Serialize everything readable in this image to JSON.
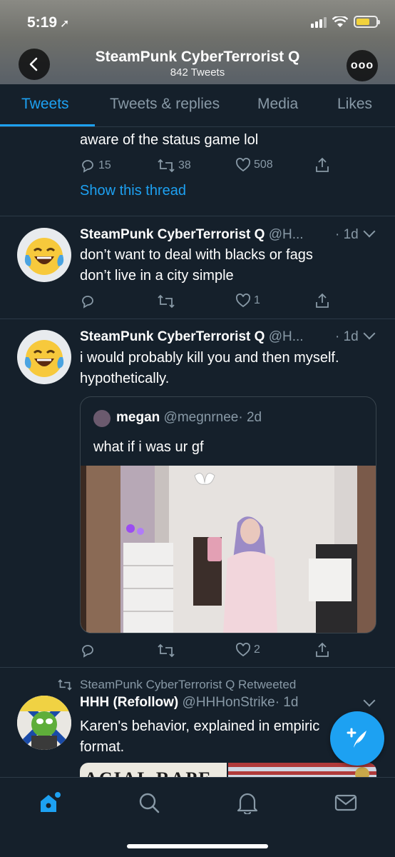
{
  "status_bar": {
    "time": "5:19"
  },
  "header": {
    "title": "SteamPunk CyberTerrorist Q",
    "subtitle": "842 Tweets",
    "more_label": "ooo"
  },
  "tabs": [
    {
      "label": "Tweets",
      "active": true
    },
    {
      "label": "Tweets & replies",
      "active": false
    },
    {
      "label": "Media",
      "active": false
    },
    {
      "label": "Likes",
      "active": false
    }
  ],
  "tweet0": {
    "text": "aware of the status game lol",
    "replies": "15",
    "retweets": "38",
    "likes": "508",
    "thread_link": "Show this thread"
  },
  "tweet1": {
    "name": "SteamPunk CyberTerrorist Q",
    "handle": "@H...",
    "time": "· 1d",
    "line1": "don’t want to deal with blacks or fags",
    "line2": "don’t live in a city simple",
    "likes": "1"
  },
  "tweet2": {
    "name": "SteamPunk CyberTerrorist Q",
    "handle": "@H...",
    "time": "· 1d",
    "line1": "i would probably kill you and then myself.",
    "line2": "hypothetically.",
    "likes": "2",
    "quote": {
      "name": "megan",
      "handle": "@megnrnee",
      "time": "· 2d",
      "text": "what if i was ur gf"
    }
  },
  "tweet3": {
    "retweet_label": "SteamPunk CyberTerrorist Q Retweeted",
    "name": "HHH (Refollow)",
    "handle": "@HHHonStrike",
    "time": "· 1d",
    "line1": "Karen's behavior, explained in empiric",
    "line2": "format.",
    "media_text": "ACIAL RAPE"
  },
  "colors": {
    "background": "#15202b",
    "accent": "#1da1f2",
    "muted": "#8899a6"
  },
  "icons": [
    "back-icon",
    "more-icon",
    "reply-icon",
    "retweet-icon",
    "like-icon",
    "share-icon",
    "home-icon",
    "search-icon",
    "bell-icon",
    "mail-icon",
    "compose-icon"
  ]
}
